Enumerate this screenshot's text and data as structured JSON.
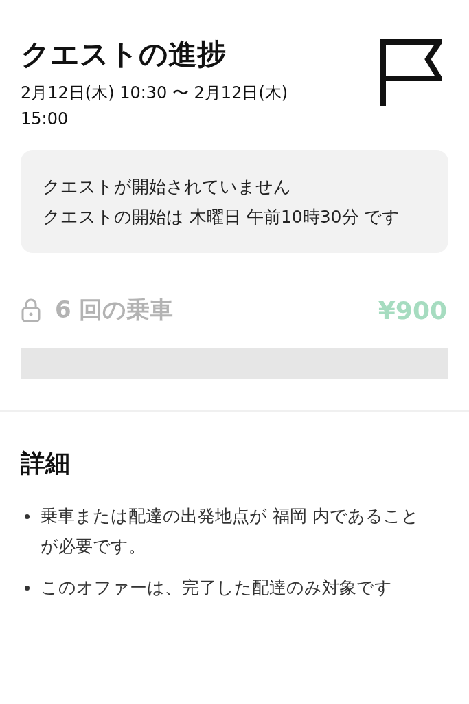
{
  "header": {
    "title": "クエストの進捗",
    "period": "2月12日(木) 10:30 〜 2月12日(木) 15:00"
  },
  "notice": {
    "lines": [
      "クエストが開始されていません",
      "クエストの開始は 木曜日 午前10時30分 です"
    ]
  },
  "goal": {
    "locked": true,
    "label": "6 回の乗車",
    "reward": "¥900",
    "level": 0
  },
  "details": {
    "title": "詳細",
    "items": [
      "乗車または配達の出発地点が 福岡 内であることが必要です。",
      "このオファーは、完了した配達のみ対象です"
    ]
  }
}
